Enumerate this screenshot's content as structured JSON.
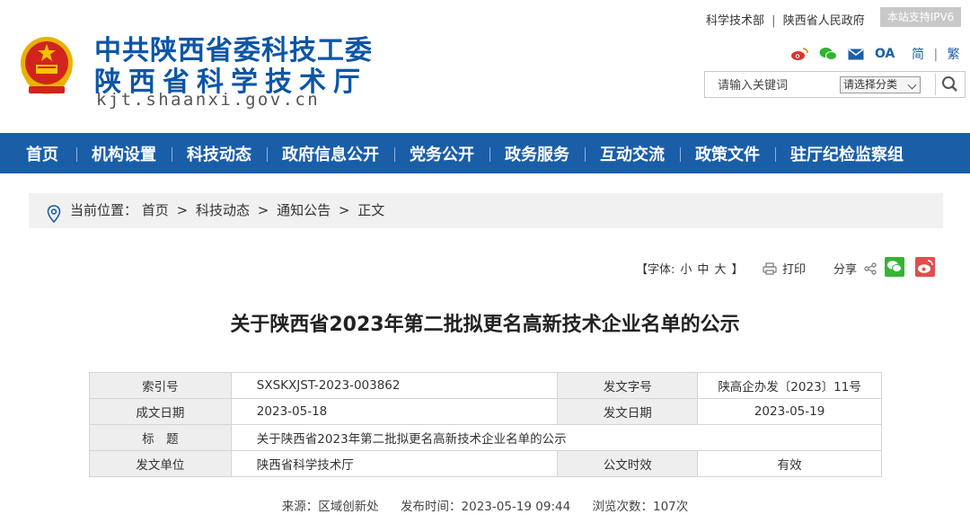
{
  "header": {
    "title_line1": "中共陕西省委科技工委",
    "title_line2": "陕西省科学技术厅",
    "domain": "kjt.shaanxi.gov.cn",
    "links": [
      "科学技术部",
      "陕西省人民政府"
    ],
    "link_sep": "|",
    "ipv6_badge": "本站支持IPV6",
    "oa_label": "OA",
    "lang_simplified": "简",
    "lang_sep": "|",
    "lang_traditional": "繁",
    "search_placeholder": "请输入关键词",
    "search_category": "请选择分类",
    "icons": [
      "weibo-icon",
      "wechat-icon",
      "mail-icon",
      "search-icon"
    ]
  },
  "nav": [
    "首页",
    "机构设置",
    "科技动态",
    "政府信息公开",
    "党务公开",
    "政务服务",
    "互动交流",
    "政策文件",
    "驻厅纪检监察组"
  ],
  "breadcrumb": {
    "prefix": "当前位置：",
    "items": [
      "首页",
      "科技动态",
      "通知公告",
      "正文"
    ],
    "sep": ">"
  },
  "tools": {
    "font_open": "【字体:",
    "font_small": "小",
    "font_medium": "中",
    "font_large": "大",
    "font_close": "】",
    "print": "打印",
    "share": "分享"
  },
  "article": {
    "title": "关于陕西省2023年第二批拟更名高新技术企业名单的公示",
    "meta": {
      "index_label": "索引号",
      "index_value": "SXSKXJST-2023-003862",
      "doc_no_label": "发文字号",
      "doc_no_value": "陕高企办发〔2023〕11号",
      "created_label": "成文日期",
      "created_value": "2023-05-18",
      "issued_label": "发文日期",
      "issued_value": "2023-05-19",
      "subject_label": "标　题",
      "subject_value": "关于陕西省2023年第二批拟更名高新技术企业名单的公示",
      "issuer_label": "发文单位",
      "issuer_value": "陕西省科学技术厅",
      "validity_label": "公文时效",
      "validity_value": "有效"
    },
    "source": "来源：区域创新处",
    "publish_time": "发布时间：2023-05-19 09:44",
    "views": "浏览次数：107次"
  },
  "colors": {
    "brand_blue": "#1a5ea8",
    "title_blue": "#0d56a6",
    "wechat_green": "#36b336",
    "weibo_red": "#e04e4e"
  }
}
